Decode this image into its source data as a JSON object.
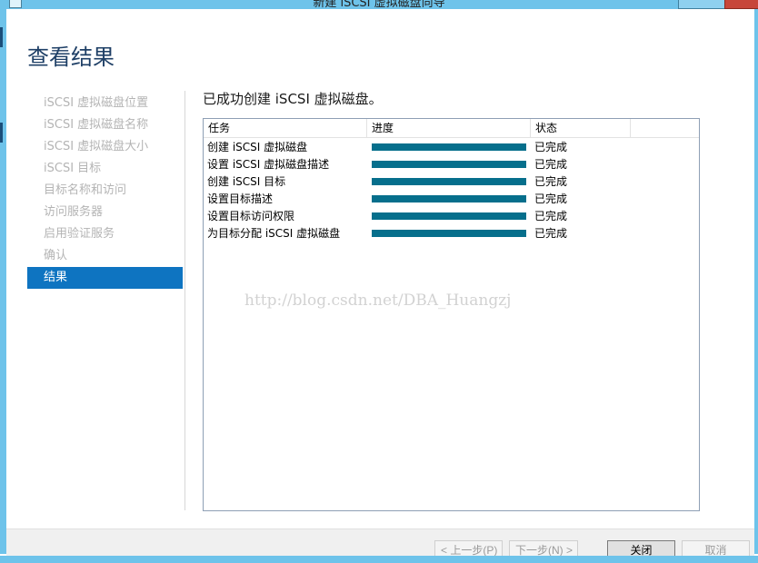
{
  "window": {
    "title": "新建 iSCSI 虚拟磁盘向导"
  },
  "page": {
    "title": "查看结果",
    "success_message": "已成功创建 iSCSI 虚拟磁盘。"
  },
  "steps": [
    {
      "label": "iSCSI 虚拟磁盘位置",
      "active": false
    },
    {
      "label": "iSCSI 虚拟磁盘名称",
      "active": false
    },
    {
      "label": "iSCSI 虚拟磁盘大小",
      "active": false
    },
    {
      "label": "iSCSI 目标",
      "active": false
    },
    {
      "label": "目标名称和访问",
      "active": false
    },
    {
      "label": "访问服务器",
      "active": false
    },
    {
      "label": "启用验证服务",
      "active": false
    },
    {
      "label": "确认",
      "active": false
    },
    {
      "label": "结果",
      "active": true
    }
  ],
  "table": {
    "columns": [
      "任务",
      "进度",
      "状态",
      ""
    ],
    "rows": [
      {
        "task": "创建 iSCSI 虚拟磁盘",
        "progress": 1.0,
        "status": "已完成"
      },
      {
        "task": "设置 iSCSI 虚拟磁盘描述",
        "progress": 1.0,
        "status": "已完成"
      },
      {
        "task": "创建 iSCSI 目标",
        "progress": 1.0,
        "status": "已完成"
      },
      {
        "task": "设置目标描述",
        "progress": 1.0,
        "status": "已完成"
      },
      {
        "task": "设置目标访问权限",
        "progress": 1.0,
        "status": "已完成"
      },
      {
        "task": "为目标分配 iSCSI 虚拟磁盘",
        "progress": 1.0,
        "status": "已完成"
      }
    ]
  },
  "watermark": "http://blog.csdn.net/DBA_Huangzj",
  "buttons": {
    "prev": "< 上一步(P)",
    "next": "下一步(N) >",
    "close": "关闭",
    "cancel": "取消"
  },
  "colors": {
    "accent": "#0e74c1",
    "progress_fill": "#066f8c",
    "title_text": "#1e3f66",
    "frame": "#6ec3ea"
  }
}
